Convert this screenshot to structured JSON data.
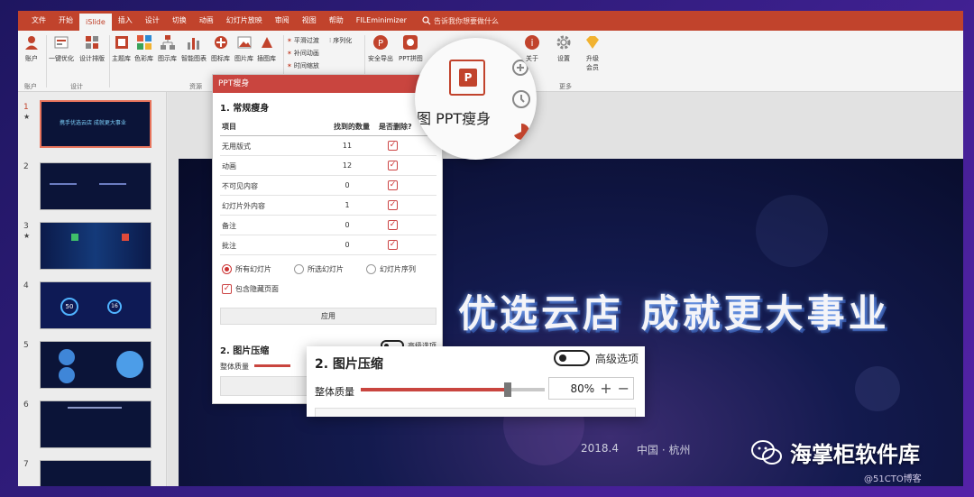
{
  "ribbon_tabs": [
    "文件",
    "开始",
    "iSlide",
    "插入",
    "设计",
    "切换",
    "动画",
    "幻灯片放映",
    "审阅",
    "视图",
    "帮助",
    "FILEminimizer"
  ],
  "tell_me": "告诉我你想要做什么",
  "ribbon": {
    "account": "账户",
    "one_click": "一键优化",
    "design_layout": "设计排版",
    "theme_lib": "主题库",
    "color_lib": "色彩库",
    "diagram_lib": "图示库",
    "smart_chart": "智能图表",
    "icon_lib": "图标库",
    "image_lib": "图片库",
    "illustration_lib": "插图库",
    "smooth_transition": "平滑过渡",
    "tween_anim": "补间动画",
    "time_scale": "时间缩放",
    "sequence": "序列化",
    "safe_export": "安全导出",
    "ppt_collage": "PPT拼图",
    "about": "关于",
    "settings": "设置",
    "upgrade": "升级",
    "member": "会员",
    "groups": {
      "account": "账户",
      "design": "设计",
      "resources": "资源",
      "animation": "动画",
      "more": "更多"
    }
  },
  "slides": [
    {
      "num": "1",
      "star": "★",
      "text": "携手优选云店 成就更大事业"
    },
    {
      "num": "2",
      "star": ""
    },
    {
      "num": "3",
      "star": "★"
    },
    {
      "num": "4",
      "star": "",
      "left": "50",
      "right": "16"
    },
    {
      "num": "5",
      "star": ""
    },
    {
      "num": "6",
      "star": ""
    },
    {
      "num": "7",
      "star": ""
    }
  ],
  "main_slide": {
    "title": "优选云店  成就更大事业",
    "date": "2018.4",
    "city": "中国 · 杭州"
  },
  "dialog": {
    "title": "PPT瘦身",
    "section1": "1. 常规瘦身",
    "headers": [
      "项目",
      "找到的数量",
      "是否删除?"
    ],
    "rows": [
      {
        "item": "无用版式",
        "count": "11",
        "checked": true
      },
      {
        "item": "动画",
        "count": "12",
        "checked": true
      },
      {
        "item": "不可见内容",
        "count": "0",
        "checked": true
      },
      {
        "item": "幻灯片外内容",
        "count": "1",
        "checked": true
      },
      {
        "item": "备注",
        "count": "0",
        "checked": true
      },
      {
        "item": "批注",
        "count": "0",
        "checked": true
      }
    ],
    "scope_options": [
      "所有幻灯片",
      "所选幻灯片",
      "幻灯片序列"
    ],
    "scope_selected": 0,
    "include_hidden": "包含隐藏页面",
    "include_hidden_checked": true,
    "apply": "应用",
    "section2": "2. 图片压缩",
    "advanced": "高级选项",
    "quality_label": "整体质量",
    "quality_value": "80%",
    "quality_level": 0.8
  },
  "magnifier": {
    "label_prefix": "图",
    "label": "PPT瘦身",
    "icon_letter": "P"
  },
  "watermark": {
    "brand": "海掌柜软件库",
    "blog": "@51CTO博客"
  },
  "colors": {
    "accent": "#c1432c",
    "dialog_header": "#c9453f",
    "slider": "#c9453f"
  }
}
